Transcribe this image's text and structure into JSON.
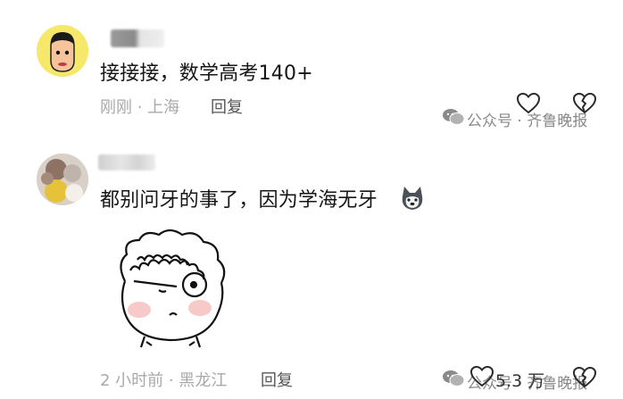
{
  "comments": [
    {
      "text": "接接接，数学高考140+",
      "location": "刚刚 · 上海",
      "reply_label": "回复"
    },
    {
      "text": "都别问牙的事了，因为学海无牙",
      "location": "2 小时前 · 黑龙江",
      "reply_label": "回复",
      "like_count": "5.3 万"
    }
  ],
  "watermark": {
    "text": "公众号 · 齐鲁晚报"
  }
}
